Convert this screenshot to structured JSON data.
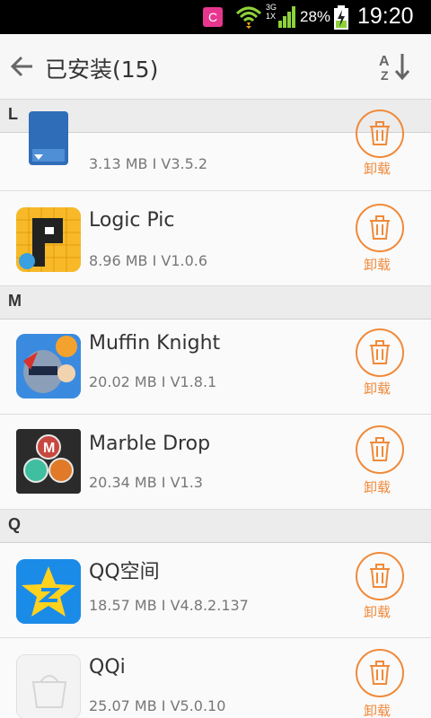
{
  "status_bar": {
    "notification_icon": "c-notification-icon",
    "network": "3G\n1X",
    "battery_percent": "28%",
    "time": "19:20"
  },
  "header": {
    "title": "已安装(15)",
    "back_icon": "arrow-left-icon",
    "sort_icon": "sort-az-icon"
  },
  "sections": [
    {
      "letter": "L",
      "items": [
        {
          "name": "",
          "size": "3.13 MB",
          "version": "V3.5.2",
          "uninstall_label": "卸载"
        },
        {
          "name": "Logic Pic",
          "size": "8.96 MB",
          "version": "V1.0.6",
          "uninstall_label": "卸载"
        }
      ]
    },
    {
      "letter": "M",
      "items": [
        {
          "name": "Muffin Knight",
          "size": "20.02 MB",
          "version": "V1.8.1",
          "uninstall_label": "卸载"
        },
        {
          "name": "Marble Drop",
          "size": "20.34 MB",
          "version": "V1.3",
          "uninstall_label": "卸载"
        }
      ]
    },
    {
      "letter": "Q",
      "items": [
        {
          "name": "QQ空间",
          "size": "18.57 MB",
          "version": "V4.8.2.137",
          "uninstall_label": "卸载"
        },
        {
          "name": "QQi",
          "size": "25.07 MB",
          "version": "V5.0.10",
          "uninstall_label": "卸载"
        }
      ]
    }
  ],
  "separator": "I"
}
